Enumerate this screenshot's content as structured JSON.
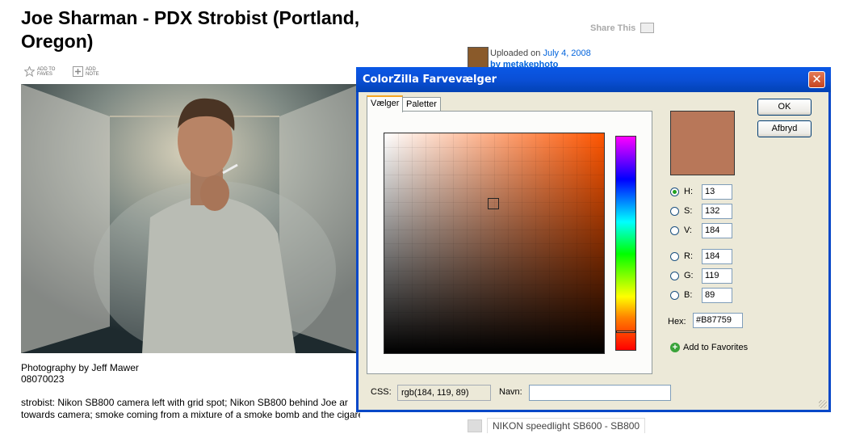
{
  "page": {
    "title": "Joe Sharman - PDX Strobist (Portland, Oregon)",
    "toolbar": [
      {
        "label": "ADD TO FAVES",
        "icon": "star-icon"
      },
      {
        "label": "ADD NOTE",
        "icon": "add-note-icon"
      }
    ],
    "caption_line1": "Photography by Jeff Mawer",
    "caption_line2": "08070023",
    "desc_line1": "strobist: Nikon SB800 camera left with grid spot; Nikon SB800 behind Joe ar",
    "desc_line2": "towards camera; smoke coming from a mixture of a smoke bomb and the cigarette",
    "share_label": "Share This",
    "uploaded_prefix": "Uploaded on",
    "uploaded_date": "July 4, 2008",
    "uploader": "by metakephoto",
    "bottom_item": "NIKON speedlight SB600 - SB800"
  },
  "dialog": {
    "title": "ColorZilla Farvevælger",
    "close_label": "✕",
    "tabs": [
      "Vælger",
      "Paletter"
    ],
    "active_tab": 0,
    "ok_label": "OK",
    "cancel_label": "Afbryd",
    "fields": [
      {
        "label": "H:",
        "value": "13",
        "selected": true
      },
      {
        "label": "S:",
        "value": "132",
        "selected": false
      },
      {
        "label": "V:",
        "value": "184",
        "selected": false
      },
      {
        "label": "R:",
        "value": "184",
        "selected": false
      },
      {
        "label": "G:",
        "value": "119",
        "selected": false
      },
      {
        "label": "B:",
        "value": "89",
        "selected": false
      }
    ],
    "hex_label": "Hex:",
    "hex_value": "#B87759",
    "add_favorites_label": "Add to Favorites",
    "css_label": "CSS:",
    "css_value": "rgb(184, 119, 89)",
    "name_label": "Navn:",
    "name_value": "",
    "preview_color": "#B87759",
    "hue_base_color": "#ff5500"
  }
}
